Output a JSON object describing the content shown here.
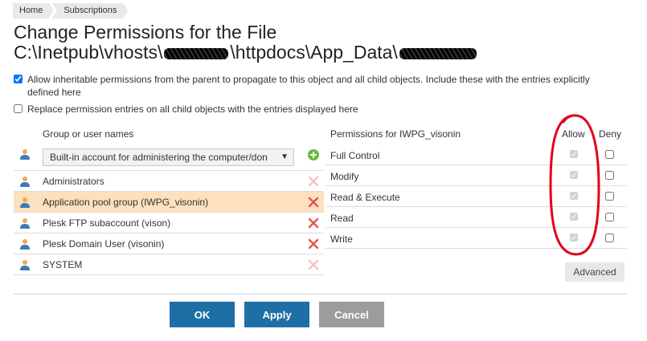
{
  "breadcrumb": [
    {
      "label": "Home"
    },
    {
      "label": "Subscriptions"
    }
  ],
  "page": {
    "title_line1": "Change Permissions for the File",
    "title_line2_a": "C:\\Inetpub\\vhosts\\",
    "title_line2_b": "\\httpdocs\\App_Data\\"
  },
  "options": {
    "inherit_label": "Allow inheritable permissions from the parent to propagate to this object and all child objects. Include these with the entries explicitly defined here",
    "inherit_checked": true,
    "replace_label": "Replace permission entries on all child objects with the entries displayed here",
    "replace_checked": false
  },
  "users": {
    "header": "Group or user names",
    "select_value": "Built-in account for administering the computer/don",
    "items": [
      {
        "label": "Administrators",
        "selected": false,
        "removable": false
      },
      {
        "label": "Application pool group (IWPG_visonin)",
        "selected": true,
        "removable": true
      },
      {
        "label": "Plesk FTP subaccount (vison)",
        "selected": false,
        "removable": true
      },
      {
        "label": "Plesk Domain User (visonin)",
        "selected": false,
        "removable": true
      },
      {
        "label": "SYSTEM",
        "selected": false,
        "removable": false
      }
    ]
  },
  "permissions": {
    "header": "Permissions for IWPG_visonin",
    "allow_label": "Allow",
    "deny_label": "Deny",
    "rows": [
      {
        "label": "Full Control",
        "allow": true,
        "deny": false
      },
      {
        "label": "Modify",
        "allow": true,
        "deny": false
      },
      {
        "label": "Read & Execute",
        "allow": true,
        "deny": false
      },
      {
        "label": "Read",
        "allow": true,
        "deny": false
      },
      {
        "label": "Write",
        "allow": true,
        "deny": false
      }
    ],
    "advanced_label": "Advanced"
  },
  "buttons": {
    "ok": "OK",
    "apply": "Apply",
    "cancel": "Cancel"
  },
  "colors": {
    "primary_button": "#1e6fa6",
    "cancel_button": "#9c9c9c",
    "selected_row": "#fde0bd",
    "remove_icon": "#e0584a",
    "add_icon": "#6ab73c",
    "annotation": "#e3001b"
  }
}
